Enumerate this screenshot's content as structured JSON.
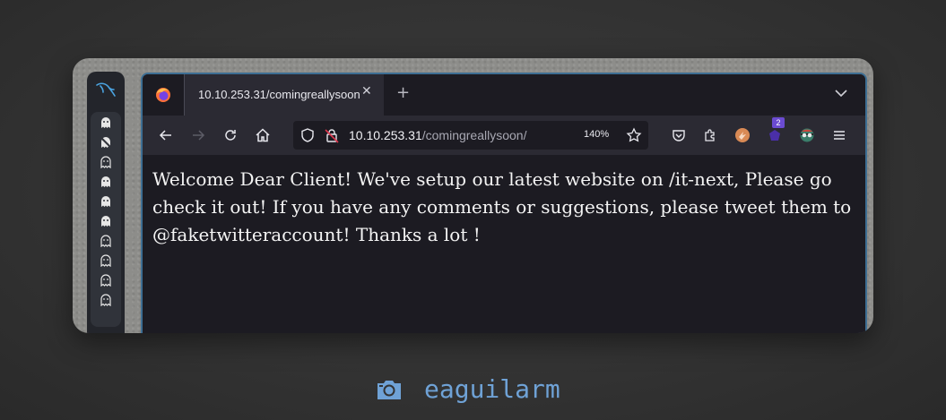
{
  "browser": {
    "tab": {
      "title": "10.10.253.31/comingreallysoon/"
    },
    "new_tab_symbol": "+",
    "url": {
      "host": "10.10.253.31",
      "path": "/comingreallysoon/"
    },
    "zoom": "140%",
    "extension_badge": "2"
  },
  "page": {
    "message": "Welcome Dear Client! We've setup our latest website on /it-next, Please go check it out! If you have any comments or suggestions, please tweet them to @faketwitteraccount! Thanks a lot !"
  },
  "dock": {
    "workspaces": [
      "ghost-filled",
      "ghost-crossed",
      "ghost-outline",
      "ghost-filled",
      "ghost-filled",
      "ghost-filled",
      "ghost-outline",
      "ghost-outline",
      "ghost-outline",
      "ghost-outline"
    ]
  },
  "caption": {
    "text": "eaguilarm",
    "icon": "camera-icon"
  },
  "colors": {
    "accent": "#3d6e93",
    "caption": "#6fa2d6",
    "background": "#1c1b22"
  }
}
